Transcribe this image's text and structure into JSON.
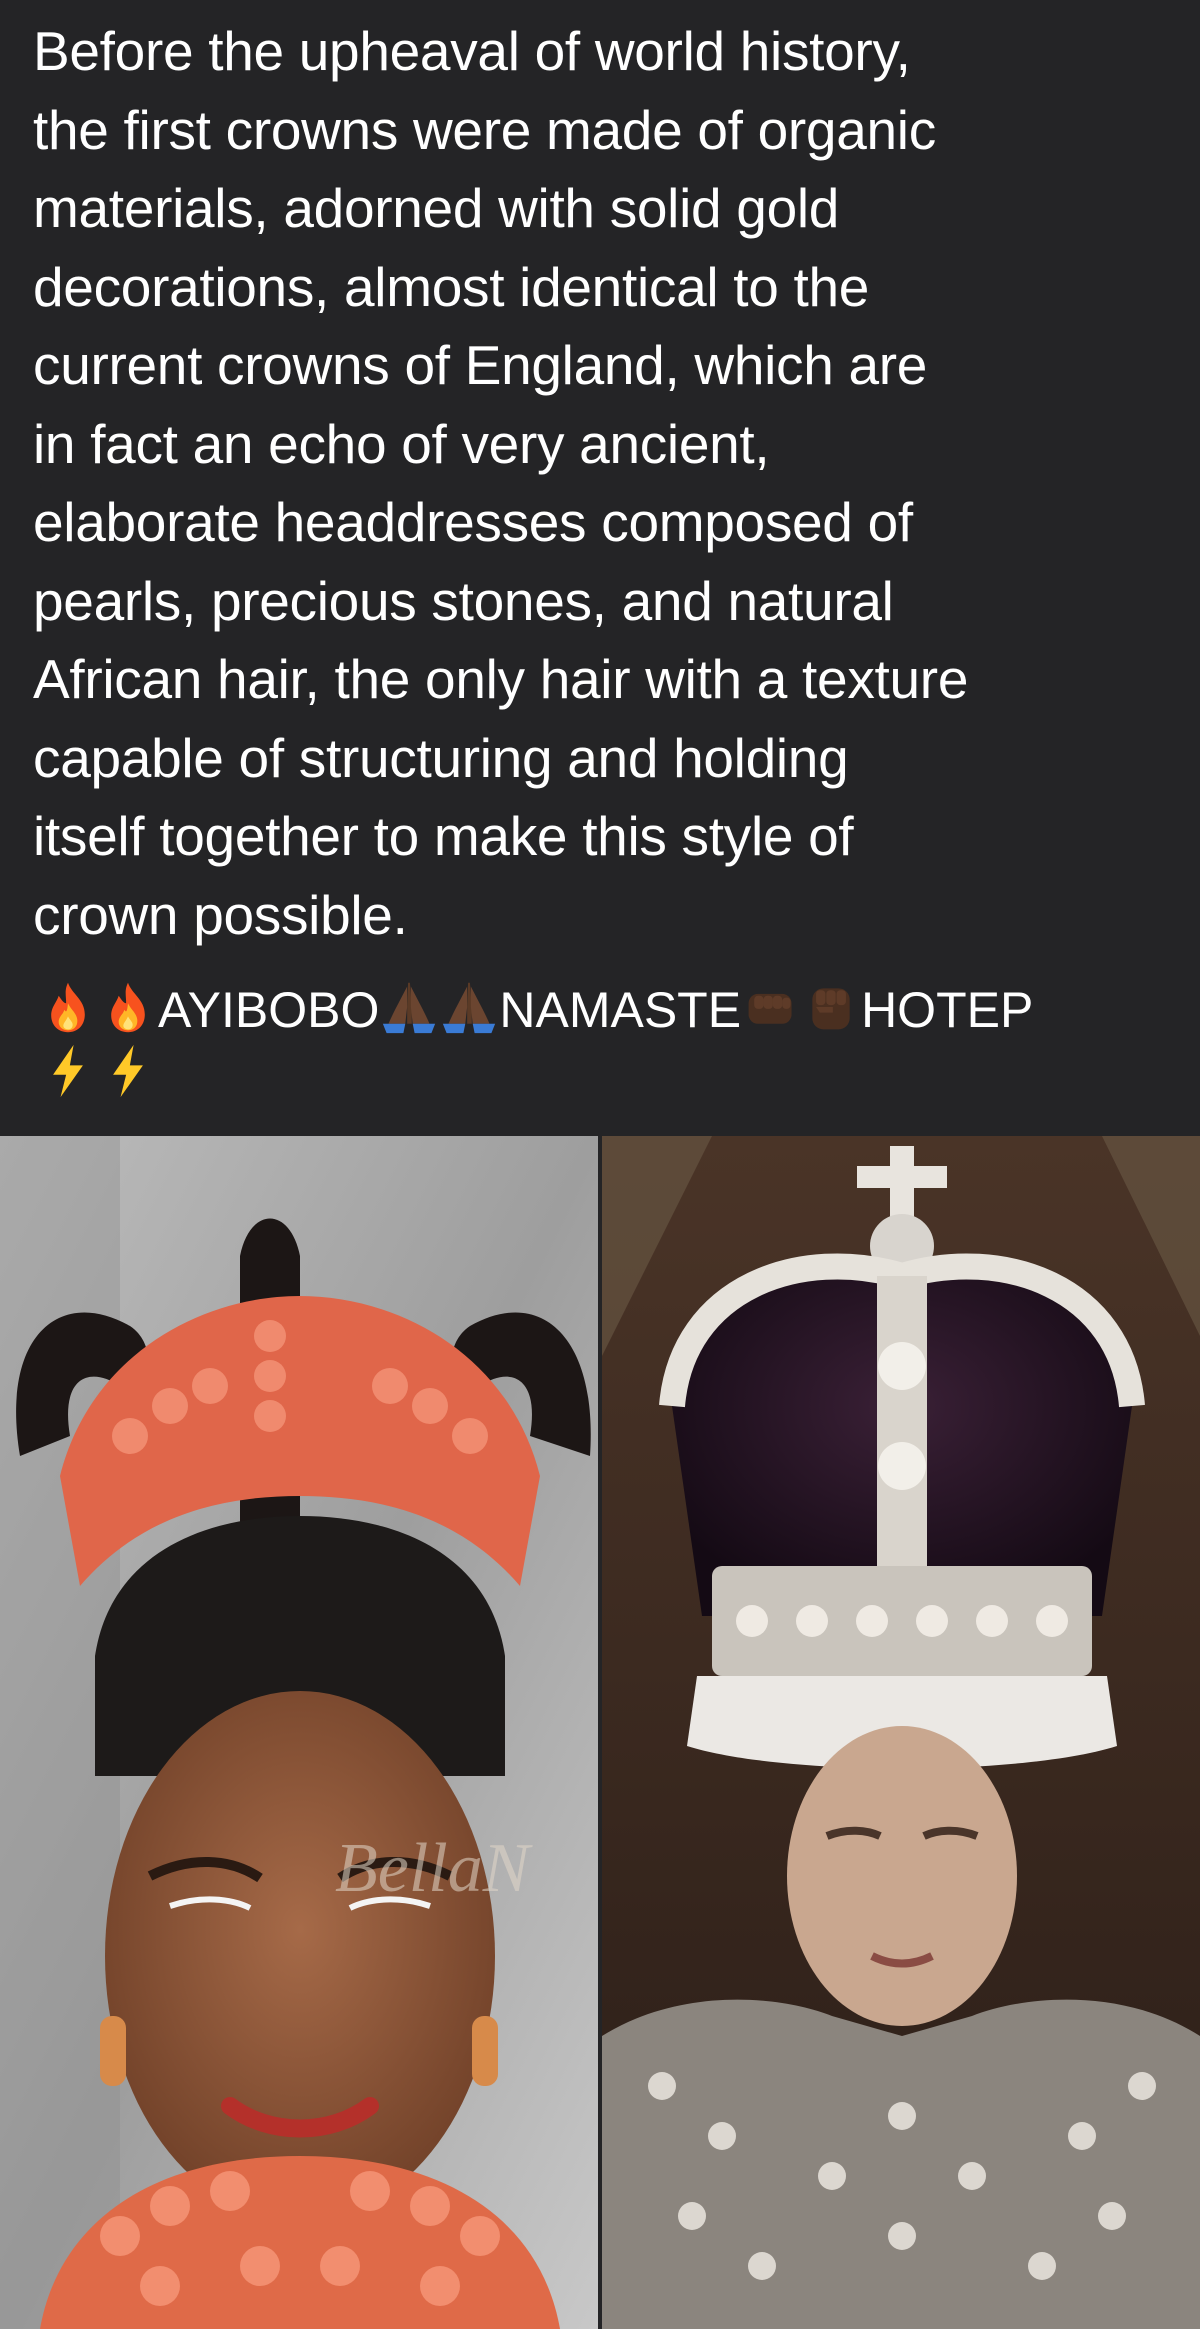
{
  "post": {
    "text": "Before the upheaval of world history,\nthe first crowns were made of organic\nmaterials, adorned with solid gold\ndecorations, almost identical to the\ncurrent crowns of England, which are\nin fact an echo of very ancient,\nelaborate headdresses composed of\npearls, precious stones, and natural\nAfrican hair, the only hair with a texture\ncapable of structuring and holding\nitself together to make this style of\ncrown possible.",
    "tagline": {
      "word1": "AYIBOBO",
      "word2": "NAMASTE",
      "word3": "HOTEP"
    },
    "icons": {
      "fire": "fire-emoji",
      "pray": "folded-hands-emoji",
      "fist": "fist-emoji",
      "bolt": "lightning-emoji"
    },
    "images": {
      "left_watermark": "BellaN"
    }
  },
  "colors": {
    "background": "#242426",
    "text": "#ffffff"
  }
}
